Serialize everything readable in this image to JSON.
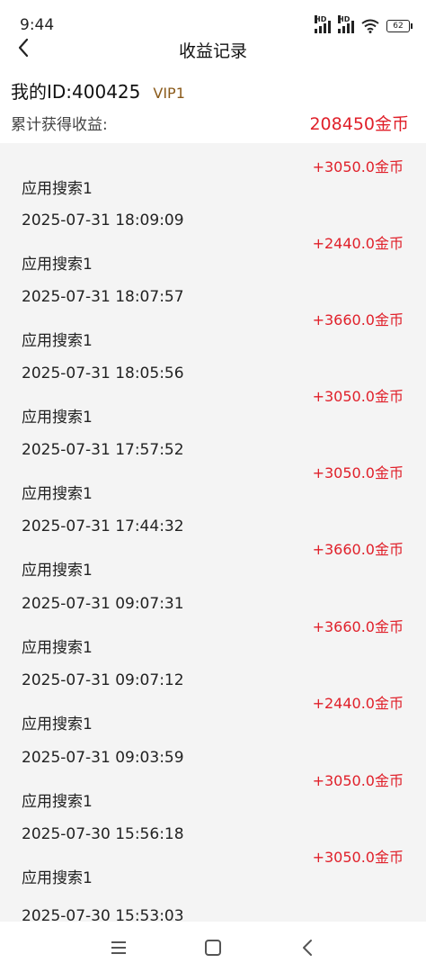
{
  "status_bar": {
    "time": "9:44",
    "signal_1_label": "HD",
    "signal_2_label": "HD",
    "battery": "62"
  },
  "header": {
    "title": "收益记录",
    "back_icon": "chevron-left-icon"
  },
  "user": {
    "id_text": "我的ID:400425",
    "vip": "VIP1"
  },
  "total": {
    "label": "累计获得收益:",
    "value": "208450金币"
  },
  "colors": {
    "accent_red": "#e0202a",
    "vip_brown": "#8a5a1a",
    "list_bg": "#f4f4f4"
  },
  "records": [
    {
      "time": "",
      "source": "应用搜索1",
      "amount": "+3050.0金币"
    },
    {
      "time": "2025-07-31 18:09:09",
      "source": "应用搜索1",
      "amount": "+2440.0金币"
    },
    {
      "time": "2025-07-31 18:07:57",
      "source": "应用搜索1",
      "amount": "+3660.0金币"
    },
    {
      "time": "2025-07-31 18:05:56",
      "source": "应用搜索1",
      "amount": "+3050.0金币"
    },
    {
      "time": "2025-07-31 17:57:52",
      "source": "应用搜索1",
      "amount": "+3050.0金币"
    },
    {
      "time": "2025-07-31 17:44:32",
      "source": "应用搜索1",
      "amount": "+3660.0金币"
    },
    {
      "time": "2025-07-31 09:07:31",
      "source": "应用搜索1",
      "amount": "+3660.0金币"
    },
    {
      "time": "2025-07-31 09:07:12",
      "source": "应用搜索1",
      "amount": "+2440.0金币"
    },
    {
      "time": "2025-07-31 09:03:59",
      "source": "应用搜索1",
      "amount": "+3050.0金币"
    },
    {
      "time": "2025-07-30 15:56:18",
      "source": "应用搜索1",
      "amount": "+3050.0金币"
    },
    {
      "time": "2025-07-30 15:53:03",
      "source": "",
      "amount": ""
    }
  ],
  "nav": {
    "menu_icon": "menu-icon",
    "home_icon": "home-square-icon",
    "back_icon": "back-triangle-icon"
  }
}
